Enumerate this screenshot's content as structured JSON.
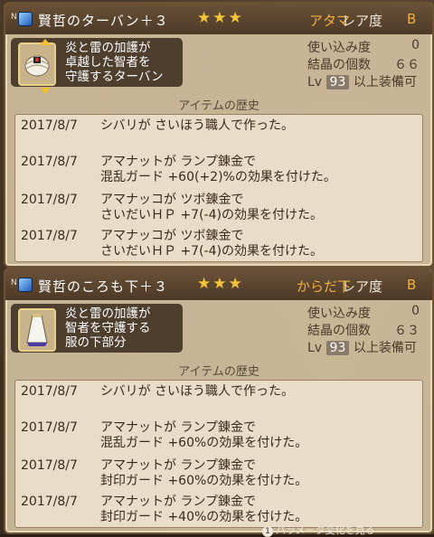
{
  "items": [
    {
      "badge": "N",
      "name": "賢哲のターバン＋３",
      "stars": "★★★",
      "slot": "アタマ",
      "rarity_label": "レア度",
      "rarity": "B",
      "description": "炎と雷の加護が\n卓越した智者を\n守護するターバン",
      "icon": "turban-icon",
      "stats": {
        "use_label": "使い込み度",
        "use_value": "0",
        "crystal_label": "結晶の個数",
        "crystal_value": "６６",
        "lv_prefix": "Lv",
        "lv_value": "93",
        "lv_suffix": "以上装備可"
      },
      "history_title": "アイテムの歴史",
      "history": [
        {
          "date": "2017/8/7",
          "text": "シバリが さいほう職人で作った。"
        },
        {
          "date": "2017/8/7",
          "text": "アマナットが ランプ錬金で\n混乱ガード +60(+2)%の効果を付けた。"
        },
        {
          "date": "2017/8/7",
          "text": "アマナッコが ツボ錬金で\nさいだいＨＰ +7(-4)の効果を付けた。"
        },
        {
          "date": "2017/8/7",
          "text": "アマナッコが ツボ錬金で\nさいだいＨＰ +7(-4)の効果を付けた。"
        }
      ]
    },
    {
      "badge": "N",
      "name": "賢哲のころも下＋３",
      "stars": "★★★",
      "slot": "からだ下",
      "rarity_label": "レア度",
      "rarity": "B",
      "description": "炎と雷の加護が\n智者を守護する\n服の下部分",
      "icon": "robe-bottom-icon",
      "stats": {
        "use_label": "使い込み度",
        "use_value": "0",
        "crystal_label": "結晶の個数",
        "crystal_value": "６３",
        "lv_prefix": "Lv",
        "lv_value": "93",
        "lv_suffix": "以上装備可"
      },
      "history_title": "アイテムの歴史",
      "history": [
        {
          "date": "2017/8/7",
          "text": "シバリが さいほう職人で作った。"
        },
        {
          "date": "2017/8/7",
          "text": "アマナットが ランプ錬金で\n混乱ガード +60%の効果を付けた。"
        },
        {
          "date": "2017/8/7",
          "text": "アマナットが ランプ錬金で\n封印ガード +60%の効果を付けた。"
        },
        {
          "date": "2017/8/7",
          "text": "アマナットが ランプ錬金で\n封印ガード +40%の効果を付けた。"
        }
      ]
    }
  ],
  "footer": {
    "button": "1",
    "label": "パラメータ変化を見る"
  }
}
